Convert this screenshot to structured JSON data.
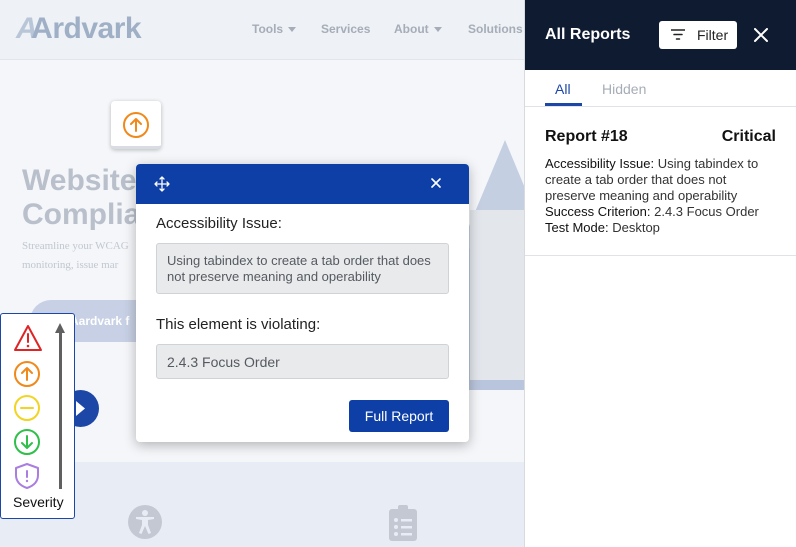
{
  "website": {
    "logo_prefix": "A",
    "logo_text": "Ardvark",
    "nav": {
      "tools": "Tools",
      "services": "Services",
      "about": "About",
      "solutions": "Solutions"
    },
    "hero_title_line1": "Website",
    "hero_title_line2": "Complia",
    "hero_sub_line1": "Streamline your WCAG",
    "hero_sub_line2": "monitoring, issue mar",
    "hero_button": "Aardvark f"
  },
  "floating_badge": {
    "icon": "arrow-up-circle-icon",
    "color": "#f0891a"
  },
  "popup": {
    "issue_label": "Accessibility Issue:",
    "issue_value": "Using tabindex to create a tab order that does not preserve meaning and operability",
    "violating_label": "This element is violating:",
    "violating_value": "2.4.3 Focus Order",
    "full_report_button": "Full Report"
  },
  "severity_legend": {
    "label": "Severity",
    "levels": [
      {
        "icon": "warning-triangle-icon",
        "color": "#e02424"
      },
      {
        "icon": "arrow-up-circle-icon",
        "color": "#f0891a"
      },
      {
        "icon": "minus-circle-icon",
        "color": "#f2d423"
      },
      {
        "icon": "arrow-down-circle-icon",
        "color": "#2fbf4a"
      },
      {
        "icon": "shield-alert-icon",
        "color": "#a97ee0"
      }
    ]
  },
  "panel": {
    "title": "All Reports",
    "filter_button": "Filter",
    "tabs": {
      "all": "All",
      "hidden": "Hidden"
    },
    "report": {
      "title": "Report #18",
      "severity": "Critical",
      "issue_label": "Accessibility Issue:",
      "issue_text": "Using tabindex to create a tab order that does not preserve meaning and operability",
      "criterion_label": "Success Criterion:",
      "criterion_text": "2.4.3 Focus Order",
      "mode_label": "Test Mode:",
      "mode_text": "Desktop"
    }
  },
  "colors": {
    "brand_blue": "#0d3fa6",
    "panel_header": "#0f1b30"
  }
}
